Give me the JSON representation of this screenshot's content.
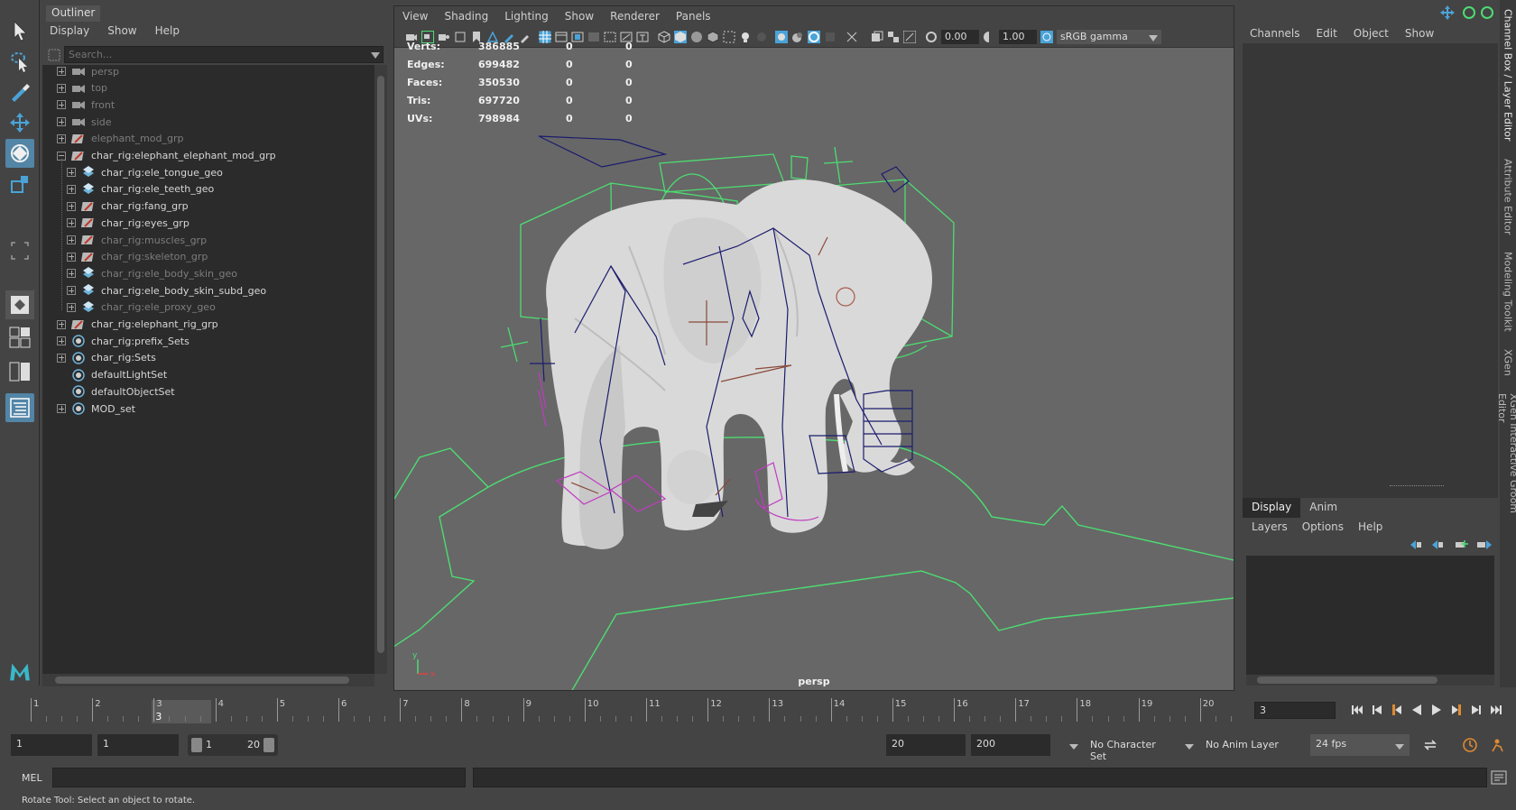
{
  "outliner": {
    "tab": "Outliner",
    "menu": [
      "Display",
      "Show",
      "Help"
    ],
    "search_placeholder": "Search...",
    "items": [
      {
        "label": "persp",
        "icon": "camera-icon",
        "indent": 0,
        "dim": true
      },
      {
        "label": "top",
        "icon": "camera-icon",
        "indent": 0,
        "dim": true
      },
      {
        "label": "front",
        "icon": "camera-icon",
        "indent": 0,
        "dim": true
      },
      {
        "label": "side",
        "icon": "camera-icon",
        "indent": 0,
        "dim": true
      },
      {
        "label": "elephant_mod_grp",
        "icon": "group-icon",
        "indent": 0,
        "dim": true
      },
      {
        "label": "char_rig:elephant_elephant_mod_grp",
        "icon": "group-icon",
        "indent": 0,
        "dim": false,
        "expanded": true
      },
      {
        "label": "char_rig:ele_tongue_geo",
        "icon": "mesh-icon",
        "indent": 1,
        "dim": false
      },
      {
        "label": "char_rig:ele_teeth_geo",
        "icon": "mesh-icon",
        "indent": 1,
        "dim": false
      },
      {
        "label": "char_rig:fang_grp",
        "icon": "group-icon",
        "indent": 1,
        "dim": false
      },
      {
        "label": "char_rig:eyes_grp",
        "icon": "group-icon",
        "indent": 1,
        "dim": false
      },
      {
        "label": "char_rig:muscles_grp",
        "icon": "group-icon",
        "indent": 1,
        "dim": true
      },
      {
        "label": "char_rig:skeleton_grp",
        "icon": "group-icon",
        "indent": 1,
        "dim": true
      },
      {
        "label": "char_rig:ele_body_skin_geo",
        "icon": "mesh-icon",
        "indent": 1,
        "dim": true
      },
      {
        "label": "char_rig:ele_body_skin_subd_geo",
        "icon": "mesh-icon",
        "indent": 1,
        "dim": false
      },
      {
        "label": "char_rig:ele_proxy_geo",
        "icon": "mesh-icon",
        "indent": 1,
        "dim": true
      },
      {
        "label": "char_rig:elephant_rig_grp",
        "icon": "group-icon",
        "indent": 0,
        "dim": false
      },
      {
        "label": "char_rig:prefix_Sets",
        "icon": "set-icon",
        "indent": 0,
        "dim": false
      },
      {
        "label": "char_rig:Sets",
        "icon": "set-icon",
        "indent": 0,
        "dim": false
      },
      {
        "label": "defaultLightSet",
        "icon": "set-icon",
        "indent": 0,
        "dim": false,
        "no_expand": true
      },
      {
        "label": "defaultObjectSet",
        "icon": "set-icon",
        "indent": 0,
        "dim": false,
        "no_expand": true
      },
      {
        "label": "MOD_set",
        "icon": "set-icon",
        "indent": 0,
        "dim": false
      }
    ]
  },
  "viewport": {
    "menu": [
      "View",
      "Shading",
      "Lighting",
      "Show",
      "Renderer",
      "Panels"
    ],
    "exposure": "0.00",
    "gamma": "1.00",
    "color_space": "sRGB gamma",
    "hud": [
      {
        "label": "Verts:",
        "v1": "386885",
        "v2": "0",
        "v3": "0"
      },
      {
        "label": "Edges:",
        "v1": "699482",
        "v2": "0",
        "v3": "0"
      },
      {
        "label": "Faces:",
        "v1": "350530",
        "v2": "0",
        "v3": "0"
      },
      {
        "label": "Tris:",
        "v1": "697720",
        "v2": "0",
        "v3": "0"
      },
      {
        "label": "UVs:",
        "v1": "798984",
        "v2": "0",
        "v3": "0"
      }
    ],
    "camera_label": "persp",
    "axis_y": "y",
    "axis_x": "x"
  },
  "channel_box": {
    "menu": [
      "Channels",
      "Edit",
      "Object",
      "Show"
    ]
  },
  "layer_editor": {
    "tabs": [
      "Display",
      "Anim"
    ],
    "menu": [
      "Layers",
      "Options",
      "Help"
    ]
  },
  "side_tabs": [
    "Channel Box / Layer Editor",
    "Attribute Editor",
    "Modeling Toolkit",
    "XGen",
    "XGen Interactive Groom Editor"
  ],
  "time_slider": {
    "ticks": [
      "1",
      "2",
      "3",
      "4",
      "5",
      "6",
      "7",
      "8",
      "9",
      "10",
      "11",
      "12",
      "13",
      "14",
      "15",
      "16",
      "17",
      "18",
      "19",
      "20"
    ],
    "current_frame": "3"
  },
  "playback": {
    "frame_field": "3"
  },
  "range": {
    "start": "1",
    "playback_start": "1",
    "slider_start": "1",
    "slider_end": "20",
    "playback_end": "20",
    "end": "200",
    "character_set": "No Character Set",
    "anim_layer": "No Anim Layer",
    "fps": "24 fps"
  },
  "command_line": {
    "label": "MEL"
  },
  "help_line": "Rotate Tool: Select an object to rotate.",
  "colors": {
    "accent": "#5285a6",
    "control_green": "#4ddc72",
    "joint_navy": "#1c1c6e",
    "magenta": "#c03cc0"
  }
}
